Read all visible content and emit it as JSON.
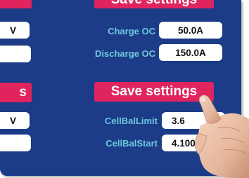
{
  "buttons": {
    "save_settings_top": "Save settings",
    "save_settings_mid": "Save settings",
    "left_top_partial": "",
    "left_mid_partial": "s"
  },
  "settings": {
    "charge_oc": {
      "label": "Charge OC",
      "value": "50.0A"
    },
    "discharge_oc": {
      "label": "Discharge OC",
      "value": "150.0A"
    },
    "cell_bal_limit": {
      "label": "CellBalLimit",
      "value": "3.6"
    },
    "cell_bal_start": {
      "label": "CellBalStart",
      "value": "4.100"
    }
  },
  "left_fields": {
    "row1": "V",
    "row2": "",
    "row3": "V",
    "row4": ""
  },
  "colors": {
    "screen_bg": "#1c3c88",
    "accent": "#e0245e",
    "label": "#6ec6da",
    "field_bg": "#ffffff"
  },
  "icons": [
    "pointing-hand-icon"
  ]
}
